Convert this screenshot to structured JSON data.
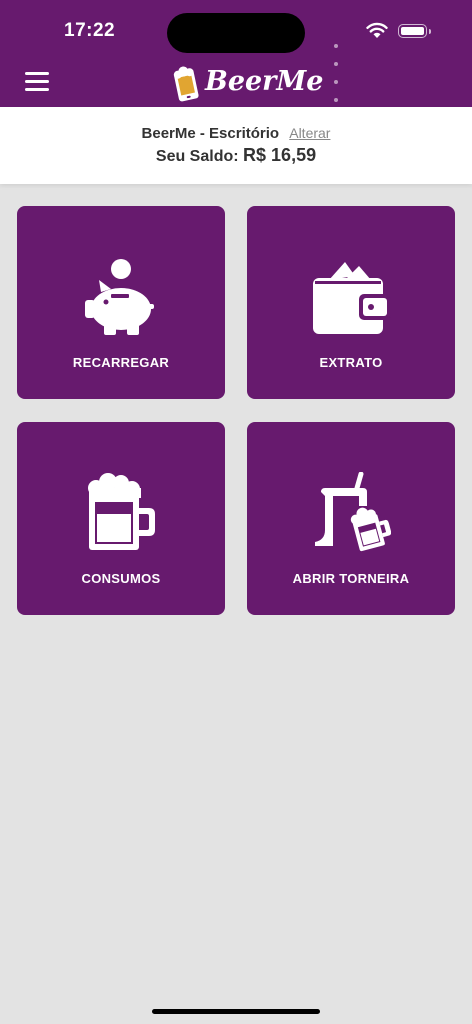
{
  "status_bar": {
    "time": "17:22"
  },
  "header": {
    "app_name": "BeerMe"
  },
  "account": {
    "name": "BeerMe - Escritório",
    "change_link": "Alterar",
    "balance_label": "Seu Saldo:",
    "balance_value": "R$ 16,59"
  },
  "tiles": [
    {
      "label": "RECARREGAR",
      "icon": "piggy-bank-icon"
    },
    {
      "label": "EXTRATO",
      "icon": "wallet-icon"
    },
    {
      "label": "CONSUMOS",
      "icon": "beer-mug-icon"
    },
    {
      "label": "ABRIR TORNEIRA",
      "icon": "beer-tap-icon"
    }
  ],
  "colors": {
    "primary": "#671a6e",
    "background": "#e3e3e3"
  }
}
